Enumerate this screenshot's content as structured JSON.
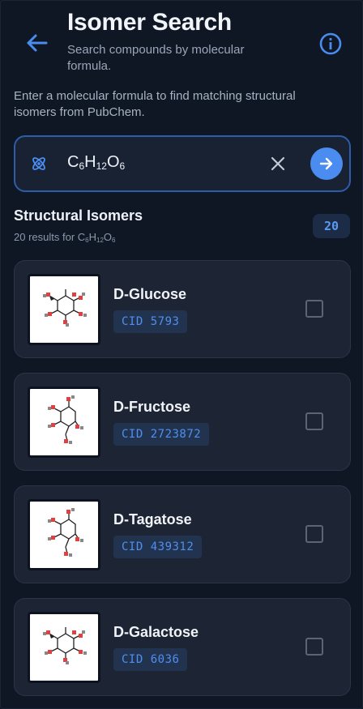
{
  "header": {
    "title": "Isomer Search",
    "subtitle": "Search compounds by molecular formula."
  },
  "intro": "Enter a molecular formula to find matching structural isomers from PubChem.",
  "search": {
    "formula_parts": [
      "C",
      "6",
      "H",
      "12",
      "O",
      "6"
    ],
    "accent": "#4a8cf0"
  },
  "results": {
    "title": "Structural Isomers",
    "subtitle_prefix": "20 results for",
    "count": "20"
  },
  "compounds": [
    {
      "name": "D-Glucose",
      "cid": "CID 5793",
      "selected": false
    },
    {
      "name": "D-Fructose",
      "cid": "CID 2723872",
      "selected": false
    },
    {
      "name": "D-Tagatose",
      "cid": "CID 439312",
      "selected": false
    },
    {
      "name": "D-Galactose",
      "cid": "CID 6036",
      "selected": false
    }
  ],
  "icons": [
    "back-arrow-icon",
    "info-icon",
    "atom-icon",
    "clear-icon",
    "arrow-right-icon"
  ]
}
